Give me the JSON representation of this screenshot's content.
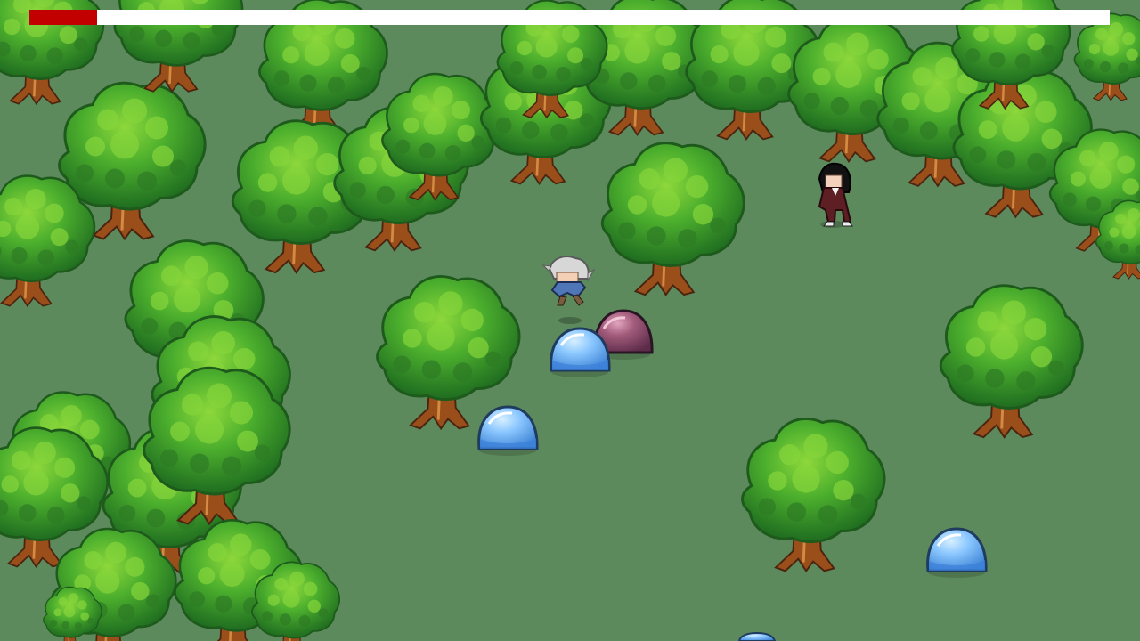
{
  "hud": {
    "health_fraction": 0.063,
    "health_fill_color": "#c30000",
    "health_track_color": "#ffffff"
  },
  "scene": {
    "ground_color": "#5c8a5c",
    "tree_leaf_color": "#3f9c2c",
    "tree_trunk_color": "#a65a22"
  },
  "entities": {
    "player": {
      "name": "player",
      "hair": "silver",
      "outfit": "blue"
    },
    "npc": {
      "name": "npc",
      "hair": "black",
      "outfit": "dark red suit"
    },
    "slimes": [
      {
        "color": "blue",
        "fill": "#79b6ee"
      },
      {
        "color": "red",
        "fill": "#8c4a6a"
      },
      {
        "color": "blue",
        "fill": "#79b6ee"
      },
      {
        "color": "blue",
        "fill": "#79b6ee"
      },
      {
        "color": "blue",
        "fill": "#79b6ee"
      }
    ]
  }
}
